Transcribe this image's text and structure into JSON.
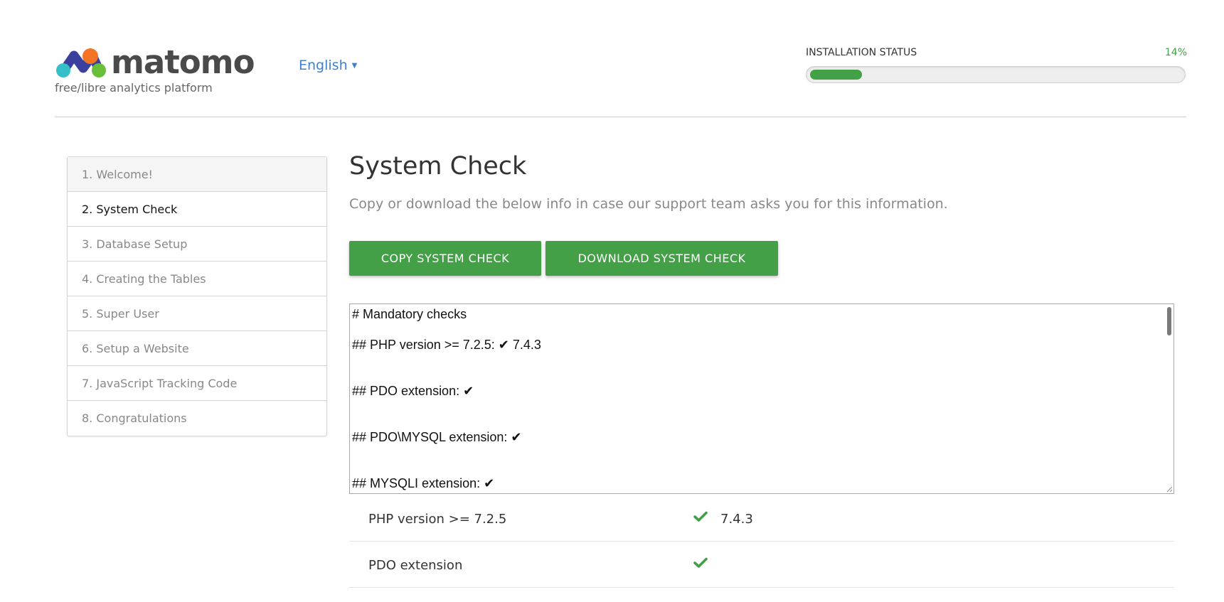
{
  "header": {
    "logo_text": "matomo",
    "tagline": "free/libre analytics platform",
    "language": "English",
    "status_label": "INSTALLATION STATUS",
    "status_percent": "14%",
    "progress_fraction": 0.14
  },
  "sidebar": {
    "steps": [
      {
        "label": "1. Welcome!"
      },
      {
        "label": "2. System Check"
      },
      {
        "label": "3. Database Setup"
      },
      {
        "label": "4. Creating the Tables"
      },
      {
        "label": "5. Super User"
      },
      {
        "label": "6. Setup a Website"
      },
      {
        "label": "7. JavaScript Tracking Code"
      },
      {
        "label": "8. Congratulations"
      }
    ],
    "active_index": 1
  },
  "main": {
    "title": "System Check",
    "intro": "Copy or download the below info in case our support team asks you for this information.",
    "copy_button": "COPY SYSTEM CHECK",
    "download_button": "DOWNLOAD SYSTEM CHECK",
    "report_lines": [
      "# Mandatory checks",
      "## PHP version >= 7.2.5: ✔ 7.4.3",
      "## PDO extension: ✔",
      "## PDO\\MYSQL extension: ✔",
      "## MYSQLI extension: ✔"
    ],
    "checks": [
      {
        "label": "PHP version >= 7.2.5",
        "icon": "check-icon",
        "value": "7.4.3"
      },
      {
        "label": "PDO extension",
        "icon": "check-icon",
        "value": ""
      }
    ]
  },
  "colors": {
    "accent_green": "#43a047",
    "link_blue": "#3f7fcf"
  }
}
